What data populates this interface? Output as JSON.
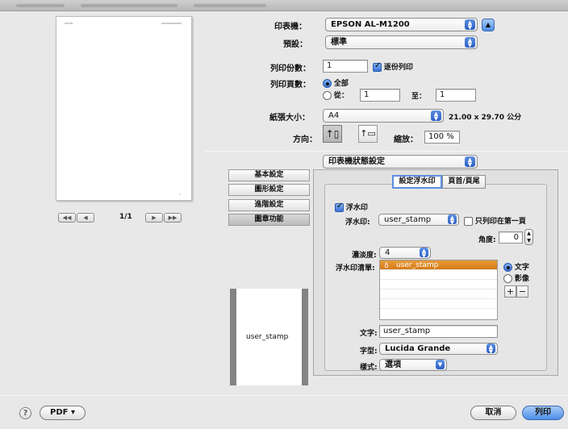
{
  "printer": {
    "label": "印表機：",
    "value": "EPSON AL-M1200"
  },
  "preset": {
    "label": "預設：",
    "value": "標準"
  },
  "copies": {
    "label": "列印份數：",
    "value": "1",
    "collate_label": "逐份列印",
    "collate_checked": true
  },
  "pages": {
    "label": "列印頁數：",
    "all_label": "全部",
    "from_label": "從：",
    "from_value": "1",
    "to_label": "至：",
    "to_value": "1"
  },
  "paper_size": {
    "label": "紙張大小：",
    "value": "A4",
    "dimensions": "21.00 x 29.70 公分"
  },
  "orientation": {
    "label": "方向："
  },
  "scale": {
    "label": "縮放：",
    "value": "100 %"
  },
  "section_popup": {
    "value": "印表機狀態設定"
  },
  "preview": {
    "page_indicator": "1/1",
    "header_text": "EPSON",
    "page_number": "1"
  },
  "side_tabs": [
    "基本設定",
    "圖形設定",
    "進階設定",
    "圖章功能"
  ],
  "segments": [
    "設定浮水印",
    "頁首/頁尾"
  ],
  "watermark": {
    "enable_label": "浮水印",
    "select_label": "浮水印:",
    "select_value": "user_stamp",
    "first_page_label": "只列印在第一頁",
    "angle_label": "角度:",
    "angle_value": "0",
    "density_label": "濃淡度:",
    "density_value": "4",
    "list_label": "浮水印清單:",
    "list_items": [
      "user_stamp"
    ],
    "text_radio": "文字",
    "image_radio": "影像",
    "text_label": "文字:",
    "text_value": "user_stamp",
    "font_label": "字型:",
    "font_value": "Lucida Grande",
    "style_label": "樣式:",
    "style_value": "選項"
  },
  "stamp_preview_text": "user_stamp",
  "bottom": {
    "help": "?",
    "pdf": "PDF ▾",
    "cancel": "取消",
    "print": "列印"
  },
  "colors": {
    "accent": "#3b73d6",
    "selection": "#d57b14"
  }
}
